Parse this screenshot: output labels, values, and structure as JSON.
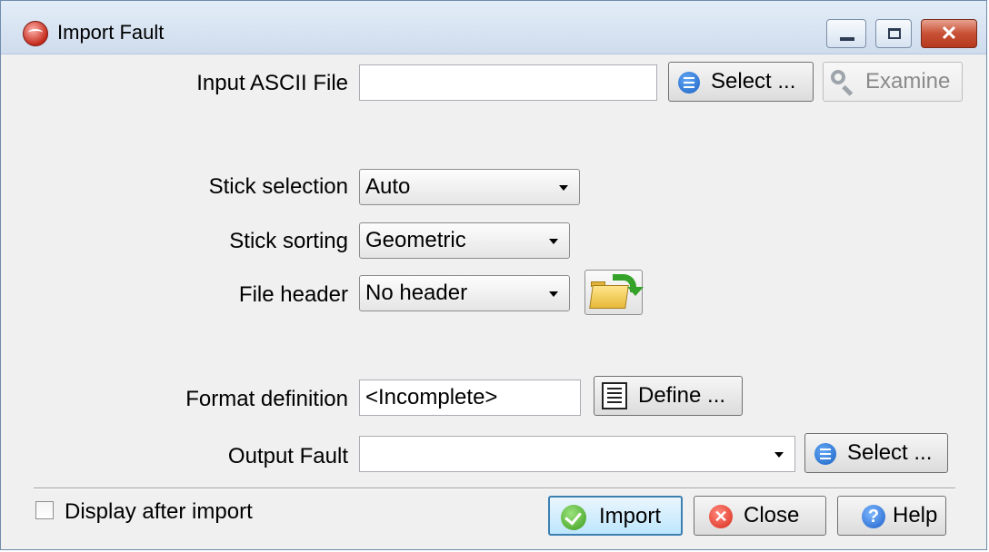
{
  "window": {
    "title": "Import Fault",
    "close_glyph": "✕"
  },
  "input_file": {
    "label": "Input ASCII File",
    "value": "",
    "select_label": "Select ...",
    "examine_label": "Examine"
  },
  "stick_selection": {
    "label": "Stick selection",
    "value": "Auto"
  },
  "stick_sorting": {
    "label": "Stick sorting",
    "value": "Geometric"
  },
  "file_header": {
    "label": "File header",
    "value": "No header"
  },
  "format_definition": {
    "label": "Format definition",
    "value": "<Incomplete>",
    "define_label": "Define ..."
  },
  "output_fault": {
    "label": "Output Fault",
    "value": "",
    "select_label": "Select ..."
  },
  "footer": {
    "display_after_import_label": "Display after import",
    "display_after_import_checked": false,
    "import_label": "Import",
    "close_label": "Close",
    "help_label": "Help",
    "close_icon_glyph": "✕",
    "help_icon_glyph": "?"
  }
}
